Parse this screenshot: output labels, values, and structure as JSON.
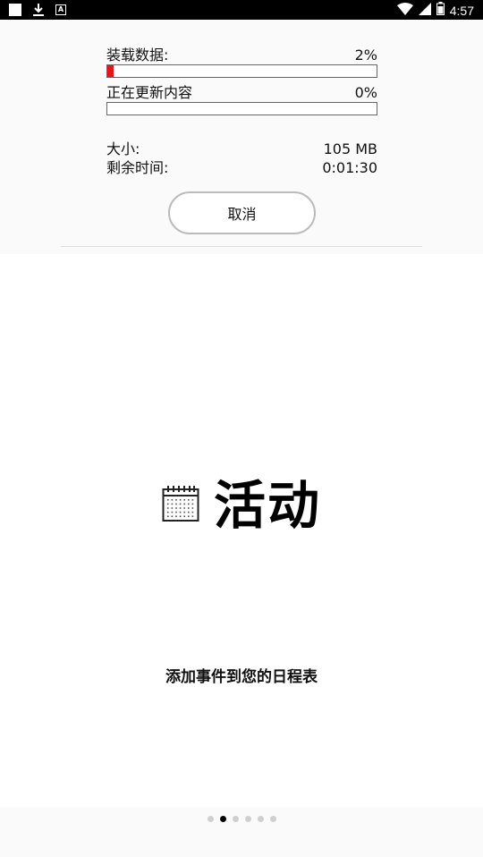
{
  "status_bar": {
    "time": "4:57",
    "left_icons": [
      "notification-square-icon",
      "download-icon",
      "a-letter-icon"
    ],
    "right_icons": [
      "wifi-icon",
      "signal-icon",
      "battery-icon"
    ]
  },
  "download": {
    "loading_label": "装载数据:",
    "loading_percent": "2%",
    "loading_progress": 0.02,
    "updating_label": "正在更新内容",
    "updating_percent": "0%",
    "updating_progress": 0,
    "size_label": "大小:",
    "size_value": "105 MB",
    "remaining_label": "剩余时间:",
    "remaining_value": "0:01:30",
    "cancel_label": "取消",
    "accent_color": "#e8141c"
  },
  "onboarding": {
    "icon": "calendar-icon",
    "title": "活动",
    "subtitle": "添加事件到您的日程表",
    "page_count": 6,
    "active_page": 1
  }
}
